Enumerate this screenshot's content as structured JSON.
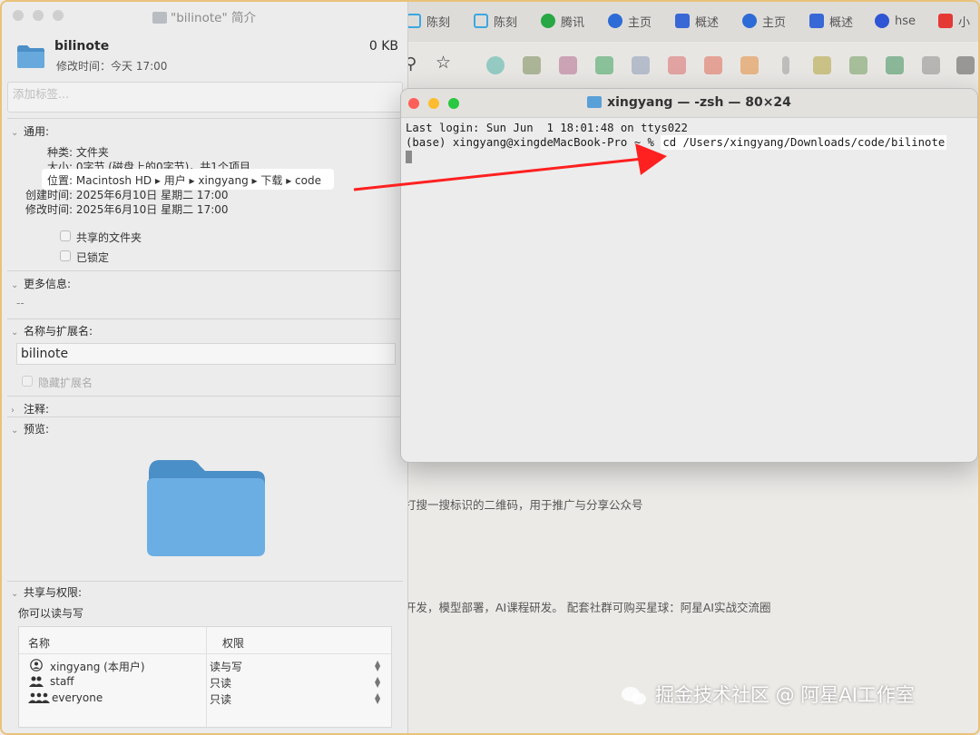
{
  "browser": {
    "tabs": [
      {
        "label": "陈刻",
        "icon": "bilibili-icon",
        "color": "#3ba7e0"
      },
      {
        "label": "陈刻",
        "icon": "bilibili-icon",
        "color": "#3ba7e0"
      },
      {
        "label": "腾讯",
        "icon": "tencent-icon",
        "color": "#28a745"
      },
      {
        "label": "主页",
        "icon": "blog-icon",
        "color": "#2d6bd6"
      },
      {
        "label": "概述",
        "icon": "doc-icon",
        "color": "#3867d6"
      },
      {
        "label": "主页",
        "icon": "blog-icon",
        "color": "#2d6bd6"
      },
      {
        "label": "概述",
        "icon": "doc-icon",
        "color": "#3867d6"
      },
      {
        "label": "hse",
        "icon": "baidu-icon",
        "color": "#2f55d4"
      },
      {
        "label": "小",
        "icon": "xiaohongshu-icon",
        "color": "#e53935"
      }
    ],
    "page_lines": [
      "打搜一搜标识的二维码，用于推广与分享公众号",
      "开发，模型部署，AI课程研发。 配套社群可购买星球：阿星AI实战交流圈"
    ]
  },
  "info_panel": {
    "title": "\"bilinote\" 简介",
    "name": "bilinote",
    "size": "0 KB",
    "modified": "修改时间：今天 17:00",
    "tags_placeholder": "添加标签...",
    "general": {
      "heading": "通用:",
      "kind": "种类: 文件夹",
      "size_line": "大小: 0字节 (磁盘上的0字节)，共1个项目",
      "location": "位置: Macintosh HD ▸ 用户 ▸ xingyang ▸ 下载 ▸ code",
      "created": "创建时间: 2025年6月10日 星期二 17:00",
      "modified": "修改时间: 2025年6月10日 星期二 17:00",
      "shared_folder": "共享的文件夹",
      "locked": "已锁定"
    },
    "more_info": {
      "heading": "更多信息:",
      "value": "--"
    },
    "name_ext": {
      "heading": "名称与扩展名:",
      "value": "bilinote",
      "hide_ext": "隐藏扩展名"
    },
    "comments": {
      "heading": "注释:"
    },
    "preview": {
      "heading": "预览:"
    },
    "sharing": {
      "heading": "共享与权限:",
      "summary": "你可以读与写",
      "col_name": "名称",
      "col_perm": "权限",
      "rows": [
        {
          "name": "xingyang (本用户)",
          "perm": "读与写"
        },
        {
          "name": "staff",
          "perm": "只读"
        },
        {
          "name": "everyone",
          "perm": "只读"
        }
      ]
    }
  },
  "terminal": {
    "title": "xingyang — -zsh — 80×24",
    "line1": "Last login: Sun Jun  1 18:01:48 on ttys022",
    "prompt": "(base) xingyang@xingdeMacBook-Pro ~ % ",
    "command": "cd /Users/xingyang/Downloads/code/bilinote"
  },
  "watermark": "掘金技术社区 @ 阿星AI工作室",
  "colors": {
    "arrow": "#ff2020",
    "folder": "#5aa0d8",
    "frame": "#e9c27a"
  }
}
